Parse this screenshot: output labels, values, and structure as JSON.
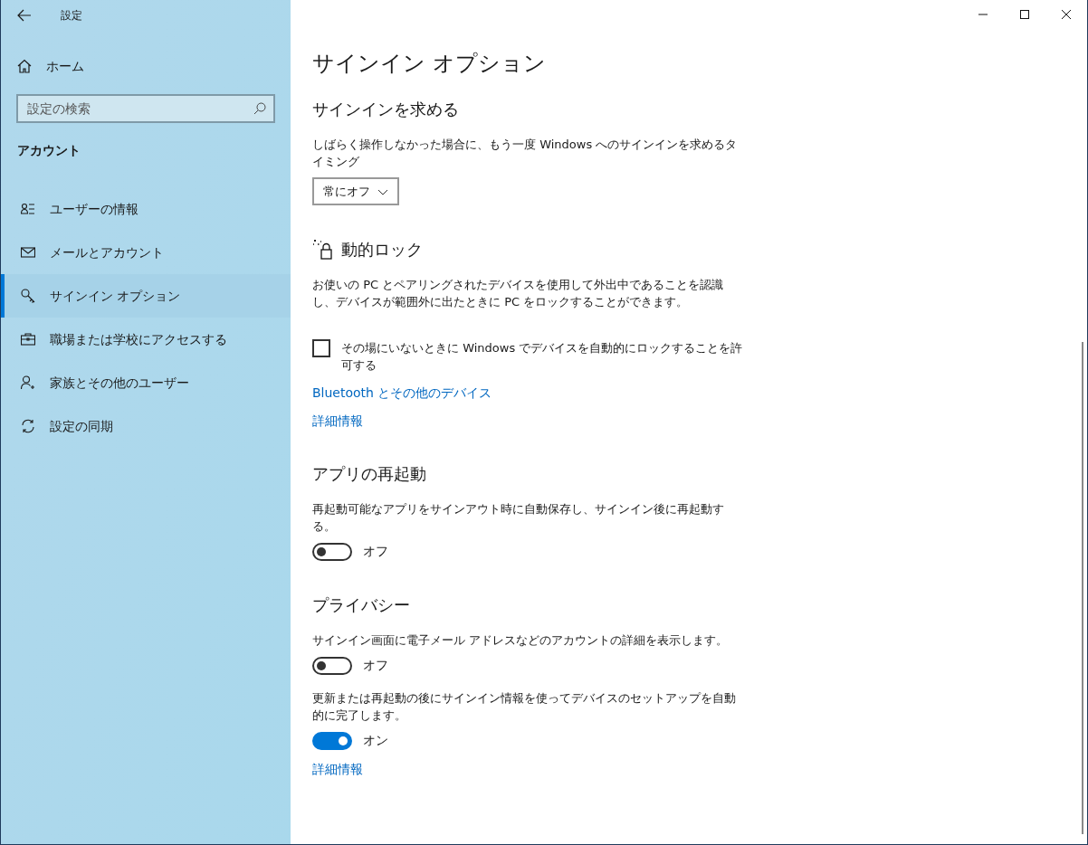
{
  "window": {
    "title": "設定"
  },
  "sidebar": {
    "home": "ホーム",
    "search": {
      "placeholder": "設定の検索"
    },
    "section": "アカウント",
    "items": [
      {
        "label": "ユーザーの情報",
        "selected": false
      },
      {
        "label": "メールとアカウント",
        "selected": false
      },
      {
        "label": "サインイン オプション",
        "selected": true
      },
      {
        "label": "職場または学校にアクセスする",
        "selected": false
      },
      {
        "label": "家族とその他のユーザー",
        "selected": false
      },
      {
        "label": "設定の同期",
        "selected": false
      }
    ]
  },
  "page": {
    "title": "サインイン オプション",
    "sections": [
      {
        "kind": "plain",
        "heading": "サインインを求める",
        "items": [
          {
            "kind": "text",
            "text": "しばらく操作しなかった場合に、もう一度 Windows へのサインインを求めるタイミング"
          },
          {
            "kind": "dropdown",
            "value": "常にオフ"
          }
        ]
      },
      {
        "kind": "dynamic_lock",
        "heading": "動的ロック",
        "items": [
          {
            "kind": "text",
            "text": "お使いの PC とペアリングされたデバイスを使用して外出中であることを認識し、デバイスが範囲外に出たときに PC をロックすることができます。"
          },
          {
            "kind": "checkbox",
            "label": "その場にいないときに Windows でデバイスを自動的にロックすることを許可する",
            "checked": false
          },
          {
            "kind": "link",
            "text": "Bluetooth とその他のデバイス"
          },
          {
            "kind": "link",
            "text": "詳細情報"
          }
        ]
      },
      {
        "kind": "plain",
        "heading": "アプリの再起動",
        "items": [
          {
            "kind": "text",
            "text": "再起動可能なアプリをサインアウト時に自動保存し、サインイン後に再起動する。"
          },
          {
            "kind": "toggle",
            "on": false,
            "state": "オフ"
          }
        ]
      },
      {
        "kind": "plain",
        "heading": "プライバシー",
        "items": [
          {
            "kind": "text",
            "text": "サインイン画面に電子メール アドレスなどのアカウントの詳細を表示します。"
          },
          {
            "kind": "toggle",
            "on": false,
            "state": "オフ"
          },
          {
            "kind": "text",
            "text": "更新または再起動の後にサインイン情報を使ってデバイスのセットアップを自動的に完了します。"
          },
          {
            "kind": "toggle",
            "on": true,
            "state": "オン"
          },
          {
            "kind": "link",
            "text": "詳細情報"
          }
        ]
      }
    ]
  }
}
